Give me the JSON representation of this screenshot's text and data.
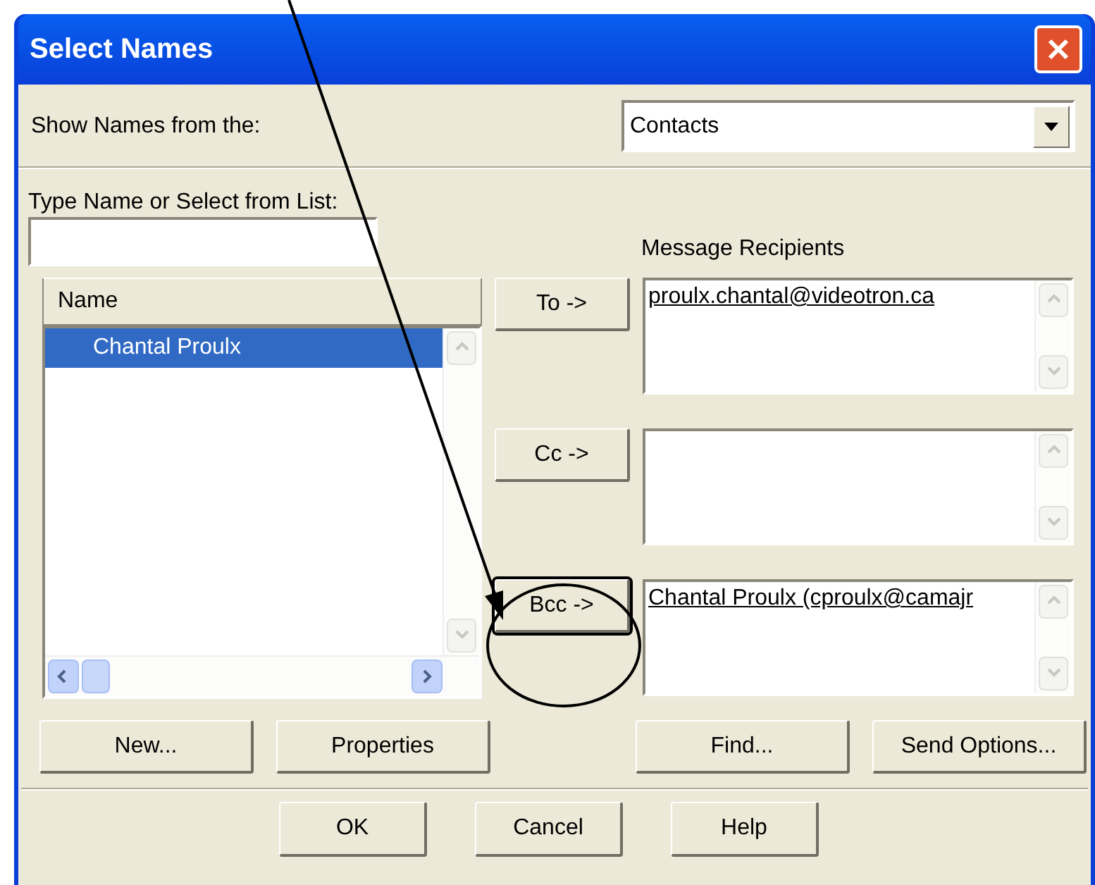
{
  "window": {
    "title": "Select Names"
  },
  "source": {
    "label": "Show Names from the:",
    "value": "Contacts"
  },
  "search": {
    "label": "Type Name or Select from List:"
  },
  "name_list": {
    "column": "Name",
    "rows": [
      {
        "name": "Chantal Proulx",
        "selected": true
      }
    ]
  },
  "recipients": {
    "label": "Message Recipients",
    "fields": [
      {
        "button": "To ->",
        "default": false,
        "entries": [
          "proulx.chantal@videotron.ca"
        ]
      },
      {
        "button": "Cc ->",
        "default": false
      },
      {
        "button": "Bcc ->",
        "default": true,
        "entries": [
          "Chantal Proulx (cproulx@camajr"
        ]
      }
    ]
  },
  "actions": [
    "New...",
    "Properties",
    "Find...",
    "Send Options..."
  ],
  "dialog_buttons": [
    "OK",
    "Cancel",
    "Help"
  ]
}
